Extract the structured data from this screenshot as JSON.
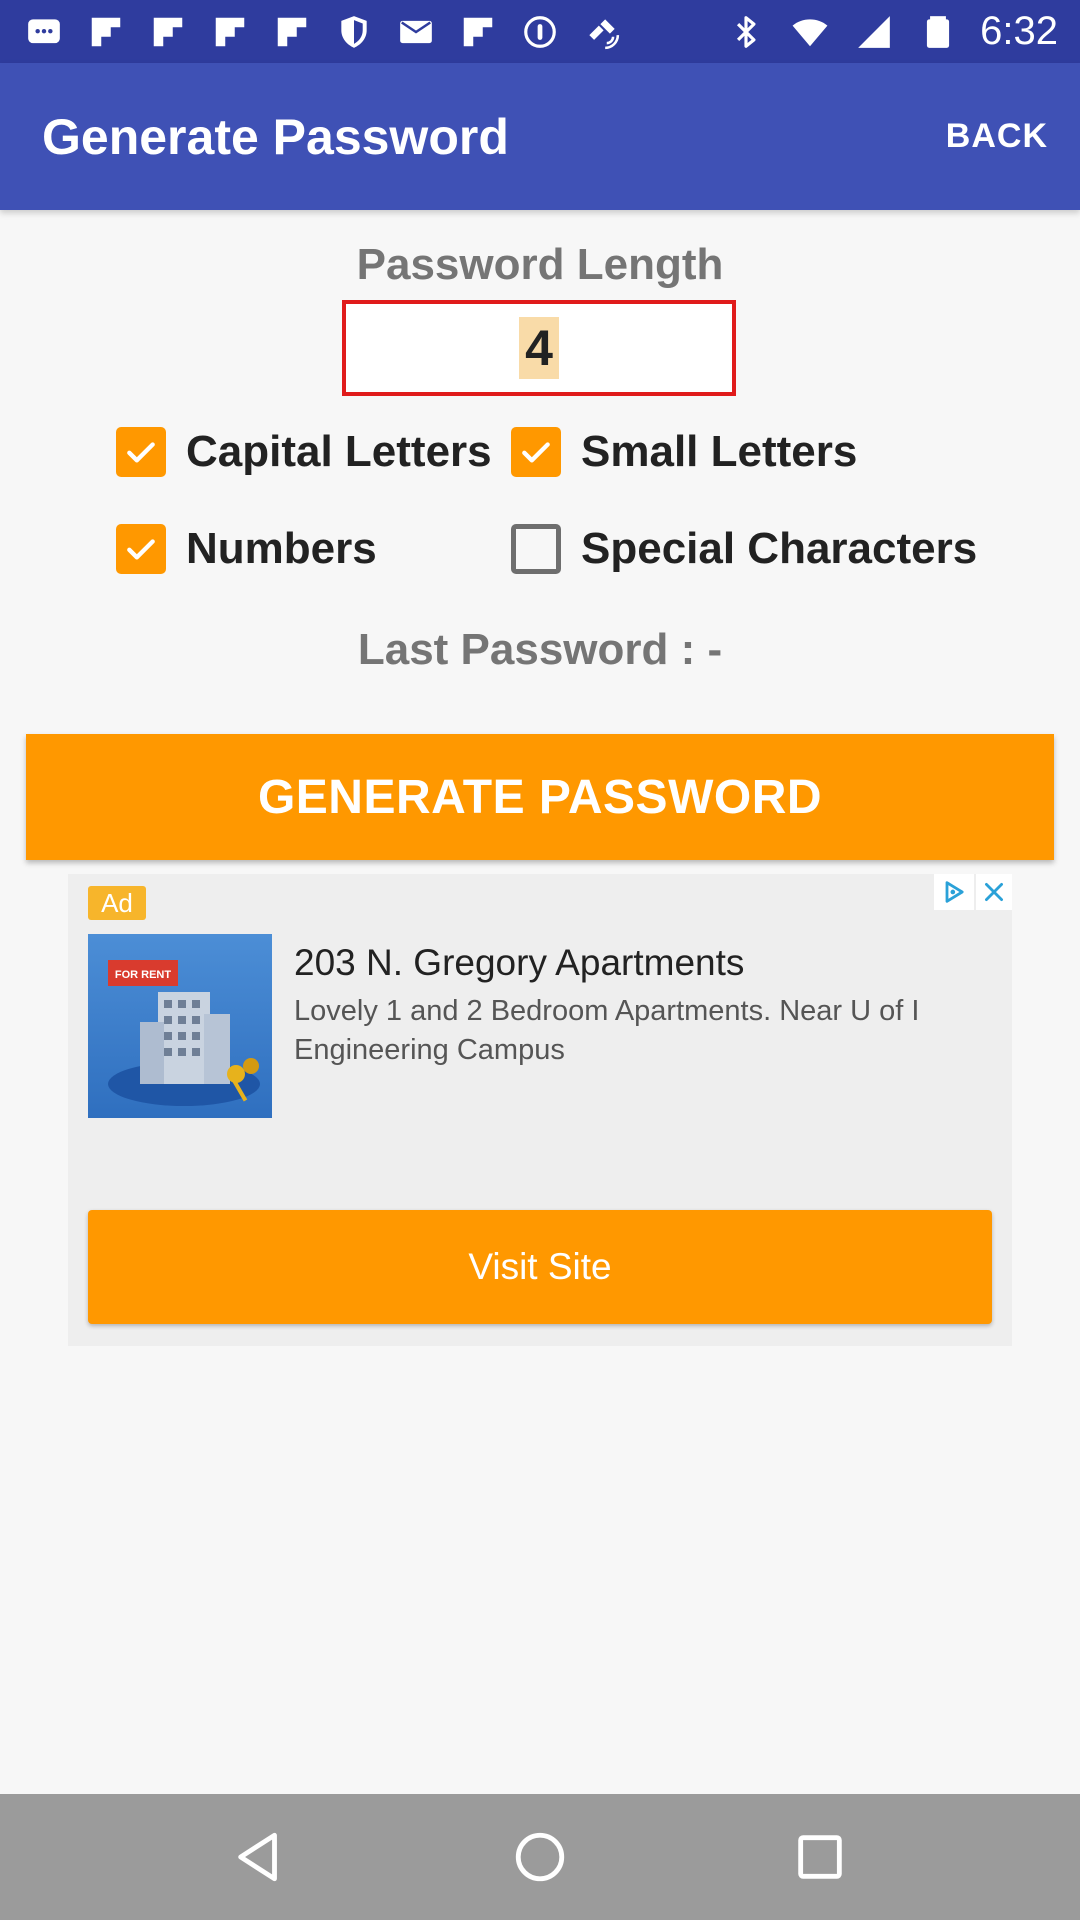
{
  "status_bar": {
    "time": "6:32",
    "left_icons": [
      "chat-icon",
      "flipboard-icon",
      "flipboard-icon",
      "flipboard-icon",
      "flipboard-icon",
      "shield-icon",
      "mail-icon",
      "flipboard-icon",
      "app-icon",
      "fake-gps-icon"
    ],
    "right_icons": [
      "bluetooth-icon",
      "wifi-icon",
      "signal-icon",
      "battery-icon"
    ]
  },
  "app_bar": {
    "title": "Generate Password",
    "back_label": "BACK",
    "color": "#3f51b5"
  },
  "form": {
    "length_label": "Password Length",
    "length_value": "4",
    "options": {
      "capital": {
        "label": "Capital Letters",
        "checked": true
      },
      "small": {
        "label": "Small Letters",
        "checked": true
      },
      "numbers": {
        "label": "Numbers",
        "checked": true
      },
      "special": {
        "label": "Special Characters",
        "checked": false
      }
    },
    "last_password": "Last Password : -",
    "generate_label": "GENERATE PASSWORD",
    "accent": "#ff9800"
  },
  "ad": {
    "badge": "Ad",
    "image_sign": "FOR RENT",
    "title": "203 N. Gregory Apartments",
    "description": "Lovely 1 and 2 Bedroom Apartments. Near U of I Engineering Campus",
    "cta": "Visit Site"
  },
  "nav_bar": {
    "buttons": [
      "back-icon",
      "home-icon",
      "recents-icon"
    ]
  }
}
